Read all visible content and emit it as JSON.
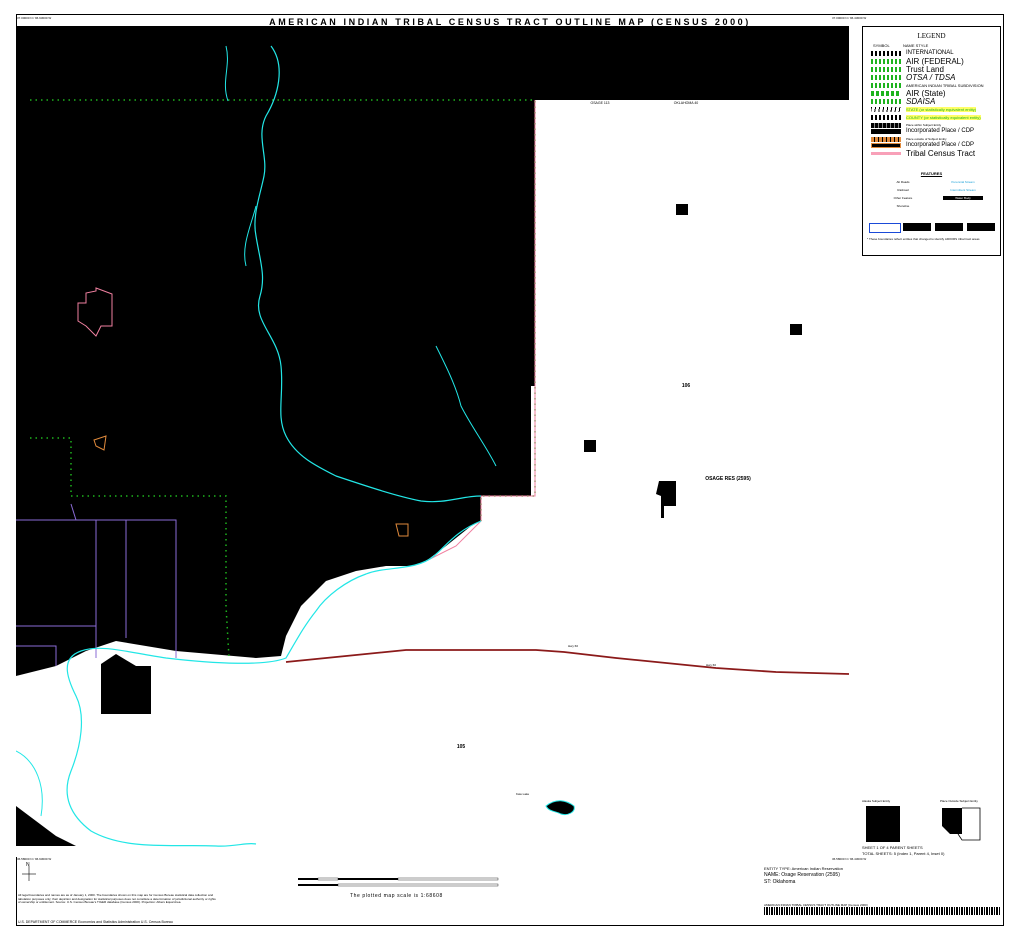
{
  "header": {
    "title": "AMERICAN INDIAN TRIBAL CENSUS TRACT OUTLINE MAP (CENSUS 2000)",
    "corner_nw": "37.00000 N / 96.93000 W",
    "corner_ne": "37.00000 N / 96.43000 W",
    "corner_sw": "36.58000 N / 96.93000 W",
    "corner_se": "36.58000 N / 96.43000 W"
  },
  "legend": {
    "title": "LEGEND",
    "symbol_header": "SYMBOL",
    "name_header": "NAME STYLE",
    "items": [
      {
        "label": "INTERNATIONAL",
        "style": "stars-black"
      },
      {
        "label": "AIR (FEDERAL)",
        "style": "green-dots"
      },
      {
        "label": "Trust Land",
        "style": "green-dots"
      },
      {
        "label": "OTSA / TDSA",
        "style": "green-dots"
      },
      {
        "label": "AMERICAN INDIAN TRIBAL SUBDIVISION",
        "style": "green-dots"
      },
      {
        "label": "AIR (State)",
        "style": "green-dashes"
      },
      {
        "label": "SDAISA",
        "style": "green-dots"
      },
      {
        "label": "STATE (or statistically equivalent entity)",
        "style": "black-slashes"
      },
      {
        "label": "COUNTY (or statistically equivalent entity)",
        "style": "black-stars"
      },
      {
        "label": "Place within Subject Entity",
        "style": "black-block"
      },
      {
        "label": "Incorporated Place / CDP",
        "style": "black-block"
      },
      {
        "label": "Place outside of Subject Entity",
        "style": "orange-block"
      },
      {
        "label": "Incorporated Place / CDP",
        "style": "orange-block"
      },
      {
        "label": "Tribal Census Tract",
        "style": "pink-line"
      }
    ],
    "features_title": "FEATURES",
    "features": [
      "Alt Roads",
      "Railroad",
      "Other Feature",
      "Shoreline",
      "Perennial Stream",
      "Intermittent Stream",
      "Water Body"
    ],
    "note": "* These boundaries reflect entities that changed to identify AIR/ORS tribal tract areas"
  },
  "map": {
    "tract_labels": [
      "106",
      "105"
    ],
    "reservation_label": "OSAGE RES (2595)",
    "county_labels": [
      "OSAGE 113",
      "OKLAHOMA 40"
    ],
    "highway_labels": [
      "Hwy 60",
      "Hwy 60",
      "Hwy 60"
    ],
    "water_label": "Kaw Lake",
    "colors": {
      "land_outside": "#000000",
      "subject_area": "#ffffff",
      "water": "#22e6e6",
      "highway": "#8b1a1a",
      "air_boundary": "#1db31d",
      "county_line": "#8a6bd6",
      "tract_line": "#f080a0",
      "place_outside": "#e08a3c"
    }
  },
  "insets": {
    "left_title": "Alaska Subject Entity",
    "right_title": "Place Outside Subject Entity"
  },
  "sheet": {
    "sheet_line": "SHEET 1 OF 4 PARENT SHEETS",
    "total_sheets": "TOTAL SHEETS: 5 (Index 1, Parent 4, Inset 0)",
    "entity_type": "ENTITY TYPE: American Indian Reservation",
    "entity_name": "NAME: Osage Reservation (2595)",
    "state": "ST: Oklahoma",
    "scale_text": "The plotted map scale is 1:68608",
    "north": "N",
    "footer_left": "U.S. DEPARTMENT OF COMMERCE Economics and Statistics Administration  U.S. Census Bureau",
    "footer_right": "AMERICAN INDIAN TRIBAL CENSUS TRACT OUTLINE MAP (Census 2000)"
  },
  "disclaimer": "All legal boundaries and names are as of January 1, 2000. The boundaries shown on this map are for Census Bureau statistical data collection and tabulation purposes only; their depiction and designation for statistical purposes does not constitute a determination of jurisdictional authority or rights of ownership or entitlement. Source: U.S. Census Bureau's TIGER database (Census 2000). Projection: Albers Equal Area."
}
